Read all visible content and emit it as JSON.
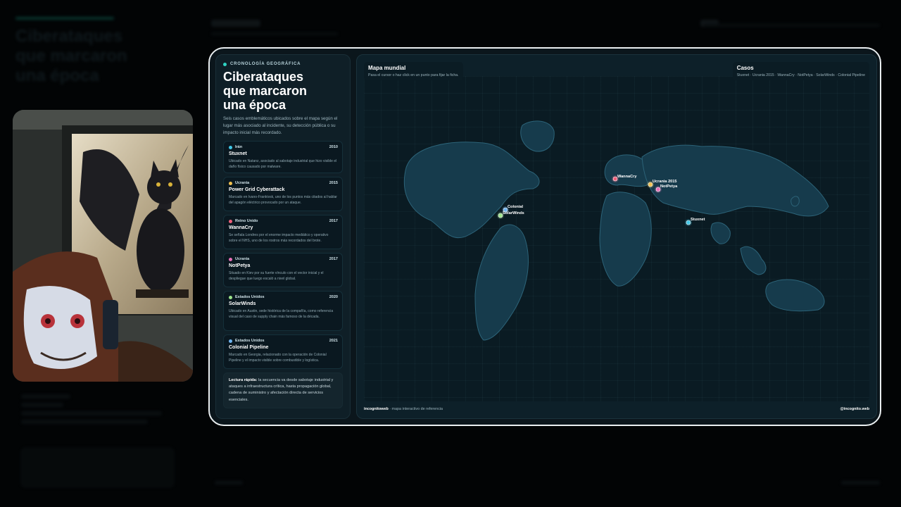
{
  "header": {
    "kicker": "CRONOLOGÍA GEOGRÁFICA",
    "title_lines": [
      "Ciberataques",
      "que marcaron",
      "una época"
    ],
    "intro": "Seis casos emblemáticos ubicados sobre el mapa según el lugar más asociado al incidente, su detección pública o su impacto inicial más recordado."
  },
  "cases": [
    {
      "country": "Irán",
      "year": "2010",
      "name": "Stuxnet",
      "color": "#3fc6e6",
      "desc": "Ubicado en Natanz, asociado al sabotaje industrial que hizo visible el daño físico causado por malware."
    },
    {
      "country": "Ucrania",
      "year": "2015",
      "name": "Power Grid Cyberattack",
      "color": "#f2c14e",
      "desc": "Marcado en Ivano-Frankivsk, uno de los puntos más citados al hablar del apagón eléctrico provocado por un ataque."
    },
    {
      "country": "Reino Unido",
      "year": "2017",
      "name": "WannaCry",
      "color": "#f0607a",
      "desc": "Se señala Londres por el enorme impacto mediático y operativo sobre el NHS, uno de los rostros más recordados del brote."
    },
    {
      "country": "Ucrania",
      "year": "2017",
      "name": "NotPetya",
      "color": "#e870b8",
      "desc": "Situado en Kiev por su fuerte vínculo con el vector inicial y el despliegue que luego escaló a nivel global."
    },
    {
      "country": "Estados Unidos",
      "year": "2020",
      "name": "SolarWinds",
      "color": "#9be38a",
      "desc": "Ubicado en Austin, sede histórica de la compañía, como referencia visual del caso de supply chain más famoso de la década."
    },
    {
      "country": "Estados Unidos",
      "year": "2021",
      "name": "Colonial Pipeline",
      "color": "#6fb4f0",
      "desc": "Marcado en Georgia, relacionado con la operación de Colonial Pipeline y el impacto visible sobre combustible y logística."
    }
  ],
  "quick_read": {
    "label": "Lectura rápida:",
    "text": " la secuencia va desde sabotaje industrial y ataques a infraestructura crítica, hasta propagación global, cadena de suministro y afectación directa de servicios esenciales."
  },
  "map": {
    "title": "Mapa mundial",
    "subtitle": "Pasa el cursor o haz click en un punto para fijar la ficha.",
    "cases_title": "Casos",
    "cases_list": "Stuxnet · Ucrania 2015 · WannaCry · NotPetya · SolarWinds · Colonial Pipeline",
    "markers": [
      {
        "label": "WannaCry",
        "color": "#f0607a"
      },
      {
        "label": "Ucrania 2015",
        "color": "#f2c14e"
      },
      {
        "label": "NotPetya",
        "color": "#e870b8"
      },
      {
        "label": "Stuxnet",
        "color": "#3fc6e6"
      },
      {
        "label": "Colonial",
        "color": "#6fb4f0"
      },
      {
        "label": "SolarWinds",
        "color": "#9be38a"
      }
    ]
  },
  "footer": {
    "brand": "incognitoweb",
    "tag": "mapa interactivo de referencia",
    "handle": "@incognito.web"
  }
}
